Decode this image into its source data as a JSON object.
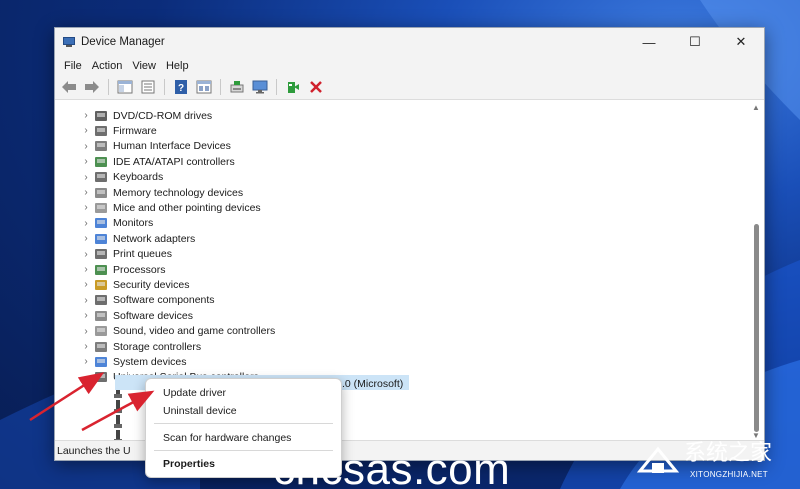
{
  "window": {
    "title": "Device Manager",
    "controls": {
      "minimize": "—",
      "maximize": "☐",
      "close": "✕"
    }
  },
  "menubar": [
    "File",
    "Action",
    "View",
    "Help"
  ],
  "toolbar": {
    "buttons": [
      "back-arrow-icon",
      "forward-arrow-icon",
      "show-hide-console-tree-icon",
      "properties-icon",
      "help-icon",
      "details-view-icon",
      "scan-hardware-icon",
      "monitor-icon",
      "enable-device-icon",
      "remove-device-icon"
    ],
    "colors": {
      "green": "#2e9b3c",
      "red": "#d0202c",
      "blue": "#2f5fa8"
    }
  },
  "tree": {
    "categories": [
      {
        "label": "DVD/CD-ROM drives",
        "icon": "dvd-drive-icon"
      },
      {
        "label": "Firmware",
        "icon": "firmware-icon"
      },
      {
        "label": "Human Interface Devices",
        "icon": "hid-icon"
      },
      {
        "label": "IDE ATA/ATAPI controllers",
        "icon": "ide-controller-icon"
      },
      {
        "label": "Keyboards",
        "icon": "keyboard-icon"
      },
      {
        "label": "Memory technology devices",
        "icon": "memory-device-icon"
      },
      {
        "label": "Mice and other pointing devices",
        "icon": "mouse-icon"
      },
      {
        "label": "Monitors",
        "icon": "monitor-icon"
      },
      {
        "label": "Network adapters",
        "icon": "network-adapter-icon"
      },
      {
        "label": "Print queues",
        "icon": "printer-icon"
      },
      {
        "label": "Processors",
        "icon": "processor-icon"
      },
      {
        "label": "Security devices",
        "icon": "security-device-icon"
      },
      {
        "label": "Software components",
        "icon": "software-component-icon"
      },
      {
        "label": "Software devices",
        "icon": "software-device-icon"
      },
      {
        "label": "Sound, video and game controllers",
        "icon": "sound-icon"
      },
      {
        "label": "Storage controllers",
        "icon": "storage-controller-icon"
      },
      {
        "label": "System devices",
        "icon": "system-device-icon"
      },
      {
        "label": "Universal Serial Bus controllers",
        "icon": "usb-icon",
        "expanded": true
      }
    ],
    "selected_suffix": ".0 (Microsoft)"
  },
  "context_menu": {
    "items": [
      "Update driver",
      "Uninstall device",
      "Scan for hardware changes",
      "Properties"
    ]
  },
  "statusbar": {
    "text": "Launches the U"
  },
  "watermarks": {
    "left": "chcsas.com",
    "right_main": "系统之家",
    "right_sub": "XITONGZHIJIA.NET"
  }
}
